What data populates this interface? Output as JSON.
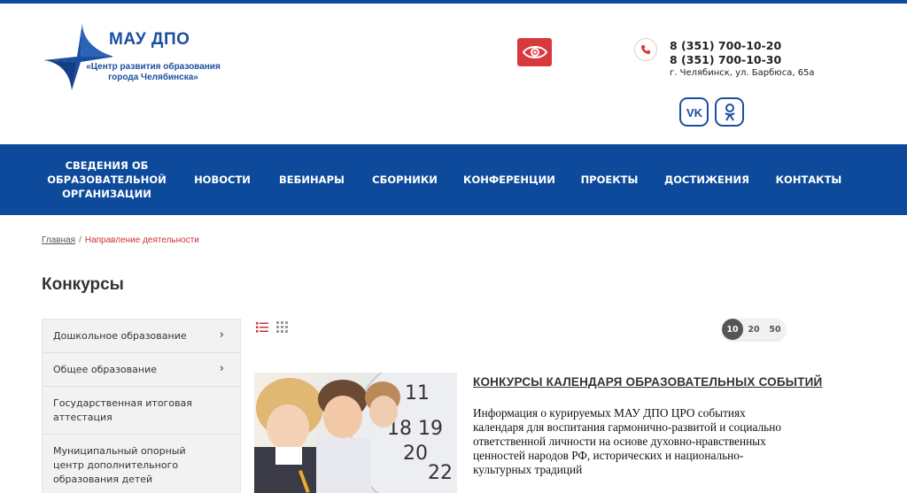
{
  "header": {
    "logo_title": "МАУ ДПО",
    "logo_subtitle_line1": "«Центр развития образования",
    "logo_subtitle_line2": "города Челябинска»",
    "phone1": "8 (351) 700-10-20",
    "phone2": "8 (351) 700-10-30",
    "address": "г. Челябинск, ул. Барбюса, 65а",
    "accessibility_icon": "eye-icon",
    "social": [
      "vk-icon",
      "odnoklassniki-icon"
    ]
  },
  "nav": {
    "items": [
      {
        "label_line1": "СВЕДЕНИЯ ОБ",
        "label_line2": "ОБРАЗОВАТЕЛЬНОЙ",
        "label_line3": "ОРГАНИЗАЦИИ"
      },
      {
        "label": "НОВОСТИ"
      },
      {
        "label": "ВЕБИНАРЫ"
      },
      {
        "label": "СБОРНИКИ"
      },
      {
        "label": "КОНФЕРЕНЦИИ"
      },
      {
        "label": "ПРОЕКТЫ"
      },
      {
        "label": "ДОСТИЖЕНИЯ"
      },
      {
        "label": "КОНТАКТЫ"
      }
    ]
  },
  "breadcrumb": {
    "home": "Главная",
    "separator": "/",
    "current": "Направление деятельности"
  },
  "page": {
    "title": "Конкурсы"
  },
  "sidebar": {
    "items": [
      {
        "label": "Дошкольное образование",
        "chevron": "›"
      },
      {
        "label": "Общее образование",
        "chevron": "›"
      },
      {
        "label": "Государственная итоговая аттестация"
      },
      {
        "label": "Муниципальный опорный центр дополнительного образования детей"
      }
    ]
  },
  "pager": {
    "options": [
      "10",
      "20",
      "50"
    ],
    "selected": "10"
  },
  "article": {
    "title": "КОНКУРСЫ КАЛЕНДАРЯ ОБРАЗОВАТЕЛЬНЫХ СОБЫТИЙ",
    "text": "Информация о курируемых МАУ ДПО ЦРО событиях календаря для воспитания гармонично-развитой и социально ответственной личности на основе духовно-нравственных ценностей народов РФ, исторических и национально-культурных традиций"
  },
  "colors": {
    "brand_blue": "#0d4a9b",
    "accent_red": "#d7393d"
  }
}
